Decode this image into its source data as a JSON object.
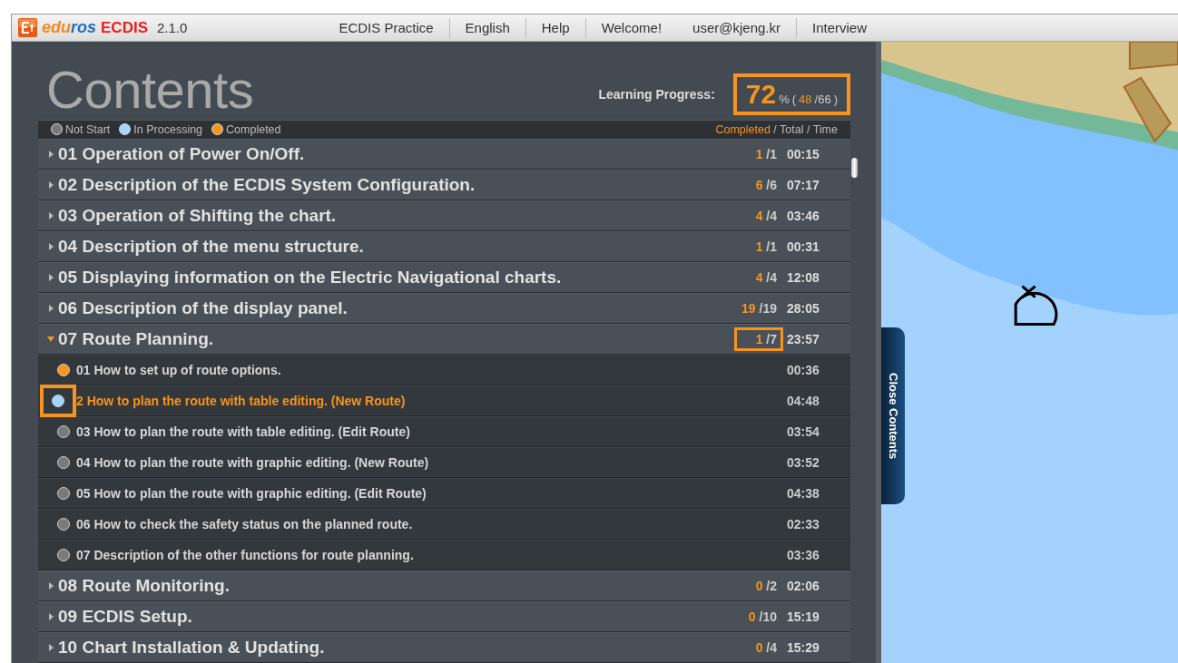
{
  "header": {
    "brand_1": "edu",
    "brand_2": "ros",
    "product": "ECDIS",
    "version": "2.1.0",
    "nav": [
      {
        "label": "ECDIS Practice",
        "divider": true
      },
      {
        "label": "English",
        "divider": true
      },
      {
        "label": "Help",
        "divider": true
      },
      {
        "label": "Welcome!",
        "divider": false
      },
      {
        "label": "user@kjeng.kr",
        "divider": true
      },
      {
        "label": "Interview",
        "divider": false
      }
    ]
  },
  "contents": {
    "title": "Contents",
    "progress": {
      "label": "Learning Progress:",
      "value": "72",
      "unit": "%",
      "open": "(",
      "done": "48",
      "total": "/66",
      "close": ")",
      "highlighted": true
    },
    "legend": [
      {
        "label": "Not Start",
        "color": "#7a7a7a"
      },
      {
        "label": "In Processing",
        "color": "#9fd6ff"
      },
      {
        "label": "Completed",
        "color": "#f7941d"
      }
    ],
    "columns": {
      "completed": "Completed",
      "rest": "/ Total / Time"
    },
    "chapters": [
      {
        "title": "01 Operation of Power On/Off.",
        "done": "1",
        "total": "/1",
        "time": "00:15",
        "expanded": false,
        "highlighted": false
      },
      {
        "title": "02 Description of the ECDIS System Configuration.",
        "done": "6",
        "total": "/6",
        "time": "07:17",
        "expanded": false,
        "highlighted": false
      },
      {
        "title": "03 Operation of Shifting the chart.",
        "done": "4",
        "total": "/4",
        "time": "03:46",
        "expanded": false,
        "highlighted": false
      },
      {
        "title": "04 Description of the menu structure.",
        "done": "1",
        "total": "/1",
        "time": "00:31",
        "expanded": false,
        "highlighted": false
      },
      {
        "title": "05 Displaying information on the Electric Navigational charts.",
        "done": "4",
        "total": "/4",
        "time": "12:08",
        "expanded": false,
        "highlighted": false
      },
      {
        "title": "06 Description of the display panel.",
        "done": "19",
        "total": "/19",
        "time": "28:05",
        "expanded": false,
        "highlighted": false
      },
      {
        "title": "07 Route Planning.",
        "done": "1",
        "total": "/7",
        "time": "23:57",
        "expanded": true,
        "highlighted": true,
        "items": [
          {
            "title": "01 How to set up of route options.",
            "time": "00:36",
            "color": "#f7941d",
            "selected": false,
            "highlighted": false
          },
          {
            "title": "2 How to plan the route with table editing. (New Route)",
            "time": "04:48",
            "color": "#9fd6ff",
            "selected": true,
            "highlighted": true
          },
          {
            "title": "03 How to plan the route with table editing. (Edit Route)",
            "time": "03:54",
            "color": "#7a7a7a",
            "selected": false,
            "highlighted": false
          },
          {
            "title": "04 How to plan the route with graphic editing. (New Route)",
            "time": "03:52",
            "color": "#7a7a7a",
            "selected": false,
            "highlighted": false
          },
          {
            "title": "05 How to plan the route with graphic editing. (Edit Route)",
            "time": "04:38",
            "color": "#7a7a7a",
            "selected": false,
            "highlighted": false
          },
          {
            "title": "06 How to check the safety status on the planned route.",
            "time": "02:33",
            "color": "#7a7a7a",
            "selected": false,
            "highlighted": false
          },
          {
            "title": "07 Description of the other functions for route planning.",
            "time": "03:36",
            "color": "#7a7a7a",
            "selected": false,
            "highlighted": false
          }
        ]
      },
      {
        "title": "08 Route Monitoring.",
        "done": "0",
        "total": "/2",
        "time": "02:06",
        "expanded": false,
        "highlighted": false
      },
      {
        "title": "09 ECDIS Setup.",
        "done": "0",
        "total": "/10",
        "time": "15:19",
        "expanded": false,
        "highlighted": false
      },
      {
        "title": "10 Chart Installation & Updating.",
        "done": "0",
        "total": "/4",
        "time": "15:29",
        "expanded": false,
        "highlighted": false
      }
    ],
    "close_tab": "Close Contents"
  }
}
